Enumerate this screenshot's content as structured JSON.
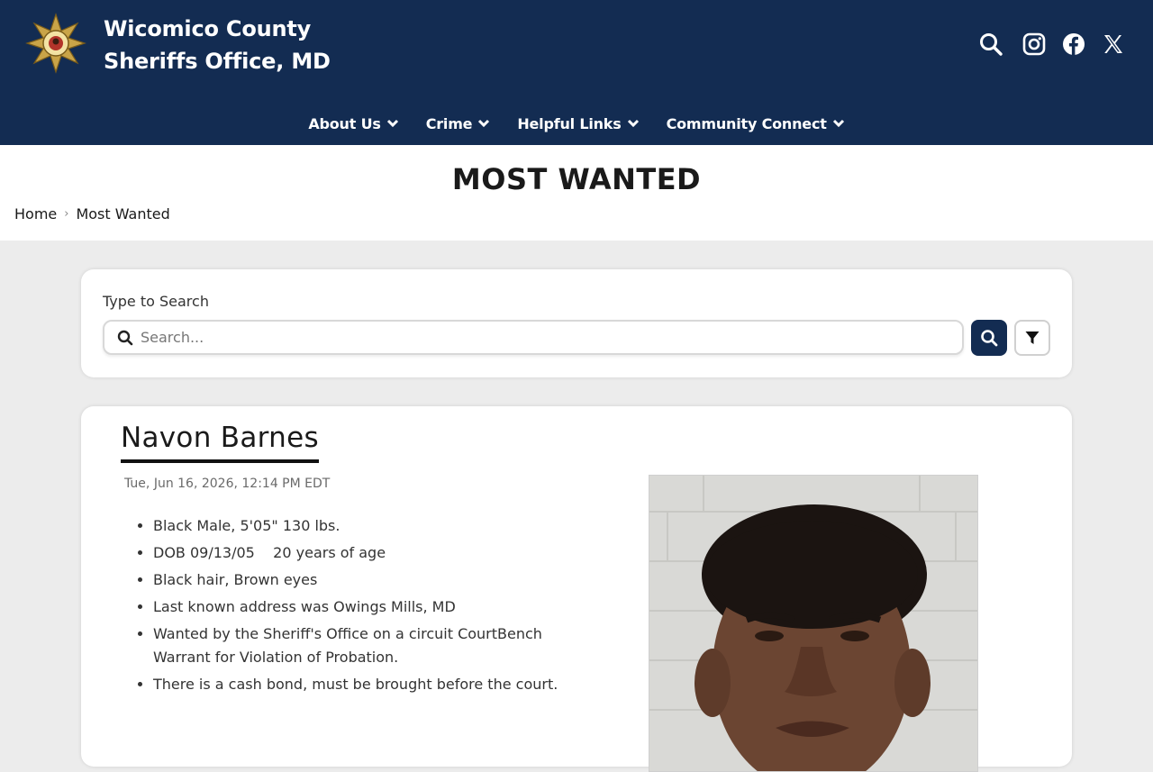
{
  "header": {
    "title_line1": "Wicomico County",
    "title_line2": "Sheriffs Office, MD",
    "social": [
      "search-icon",
      "instagram-icon",
      "facebook-icon",
      "x-icon"
    ],
    "colors": {
      "navy": "#132c52",
      "white": "#ffffff"
    }
  },
  "nav": {
    "items": [
      {
        "label": "About Us"
      },
      {
        "label": "Crime"
      },
      {
        "label": "Helpful Links"
      },
      {
        "label": "Community Connect"
      }
    ]
  },
  "page": {
    "title": "MOST WANTED",
    "breadcrumb": {
      "home": "Home",
      "separator": "›",
      "current": "Most Wanted"
    }
  },
  "search": {
    "label": "Type to Search",
    "placeholder": "Search...",
    "value": ""
  },
  "wanted": {
    "name": "Navon Barnes",
    "date": "Tue, Jun 16, 2026, 12:14 PM EDT",
    "details": [
      "Black Male, 5'05\" 130 lbs.",
      "DOB 09/13/05    20 years of age",
      "Black hair, Brown eyes",
      "Last known address was Owings Mills, MD",
      "Wanted by the Sheriff's Office on a circuit CourtBench Warrant for Violation of Probation.",
      "There is a cash bond, must be brought before the court."
    ]
  }
}
